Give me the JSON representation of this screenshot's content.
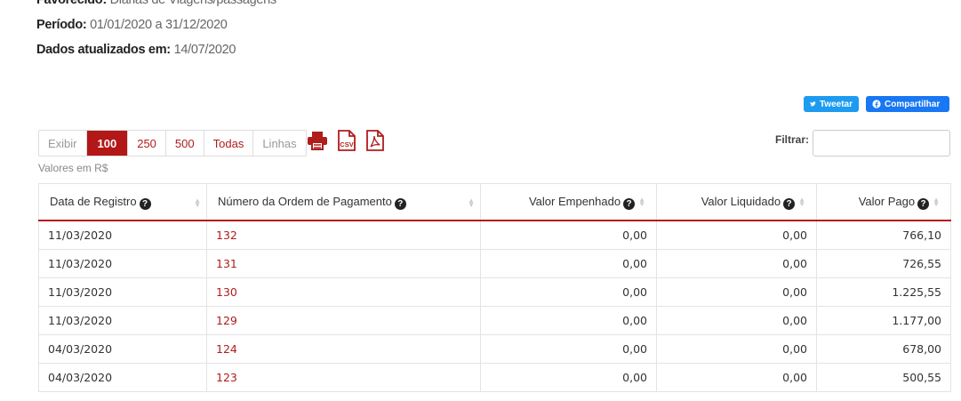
{
  "meta": {
    "favorecido_label": "Favorecido:",
    "favorecido_value": "Diárias de Viagens/passagens",
    "periodo_label": "Período:",
    "periodo_value": "01/01/2020 a 31/12/2020",
    "atualizado_label": "Dados atualizados em:",
    "atualizado_value": "14/07/2020"
  },
  "share": {
    "tweet": "Tweetar",
    "share": "Compartilhar"
  },
  "pager": {
    "show": "Exibir",
    "opt100": "100",
    "opt250": "250",
    "opt500": "500",
    "all": "Todas",
    "rows": "Linhas"
  },
  "filter": {
    "label": "Filtrar:",
    "value": ""
  },
  "caption": "Valores em R$",
  "table": {
    "headers": [
      "Data de Registro",
      "Número da Ordem de Pagamento",
      "Valor Empenhado",
      "Valor Liquidado",
      "Valor Pago"
    ],
    "rows": [
      [
        "11/03/2020",
        "132",
        "0,00",
        "0,00",
        "766,10"
      ],
      [
        "11/03/2020",
        "131",
        "0,00",
        "0,00",
        "726,55"
      ],
      [
        "11/03/2020",
        "130",
        "0,00",
        "0,00",
        "1.225,55"
      ],
      [
        "11/03/2020",
        "129",
        "0,00",
        "0,00",
        "1.177,00"
      ],
      [
        "04/03/2020",
        "124",
        "0,00",
        "0,00",
        "678,00"
      ],
      [
        "04/03/2020",
        "123",
        "0,00",
        "0,00",
        "500,55"
      ]
    ]
  },
  "colors": {
    "accent": "#b31717",
    "twitter": "#1d9bf0",
    "facebook": "#1877f2"
  }
}
